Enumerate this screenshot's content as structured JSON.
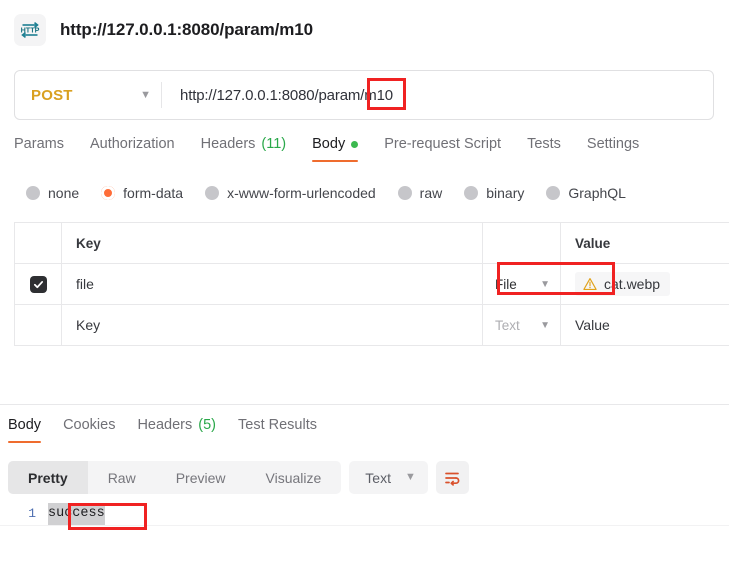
{
  "header": {
    "icon": "http-protocol-icon",
    "title": "http://127.0.0.1:8080/param/m10"
  },
  "url_bar": {
    "method": "POST",
    "method_chevron": "chevron-down-icon",
    "url": "http://127.0.0.1:8080/param/m10"
  },
  "request_tabs": [
    {
      "label": "Params",
      "active": false
    },
    {
      "label": "Authorization",
      "active": false
    },
    {
      "label": "Headers",
      "count": "(11)",
      "active": false
    },
    {
      "label": "Body",
      "active": true,
      "dot": true
    },
    {
      "label": "Pre-request Script",
      "active": false
    },
    {
      "label": "Tests",
      "active": false
    },
    {
      "label": "Settings",
      "active": false
    }
  ],
  "body_types": [
    {
      "label": "none",
      "selected": false
    },
    {
      "label": "form-data",
      "selected": true
    },
    {
      "label": "x-www-form-urlencoded",
      "selected": false
    },
    {
      "label": "raw",
      "selected": false
    },
    {
      "label": "binary",
      "selected": false
    },
    {
      "label": "GraphQL",
      "selected": false
    }
  ],
  "form_data_table": {
    "headers": {
      "key": "Key",
      "value": "Value"
    },
    "rows": [
      {
        "checked": true,
        "key": "file",
        "type": "File",
        "value": "cat.webp",
        "value_has_warning": true
      },
      {
        "checked": false,
        "key_placeholder": "Key",
        "type": "Text",
        "value_placeholder": "Value"
      }
    ]
  },
  "response_tabs": [
    {
      "label": "Body",
      "active": true
    },
    {
      "label": "Cookies",
      "active": false
    },
    {
      "label": "Headers",
      "count": "(5)",
      "active": false
    },
    {
      "label": "Test Results",
      "active": false
    }
  ],
  "response_toolbar": {
    "views": [
      {
        "label": "Pretty",
        "active": true
      },
      {
        "label": "Raw",
        "active": false
      },
      {
        "label": "Preview",
        "active": false
      },
      {
        "label": "Visualize",
        "active": false
      }
    ],
    "format": "Text",
    "format_chevron": "chevron-down-icon",
    "wrap_button": "wrap-text-icon"
  },
  "response_body": {
    "lines": [
      {
        "number": "1",
        "text": "success",
        "selected": true
      }
    ]
  },
  "annotations": {
    "url_param": "m10",
    "file_value": "cat.webp",
    "response_text": "success",
    "color": "#f02222"
  },
  "colors": {
    "accent_orange": "#ff6c37",
    "method_post": "#d9a020",
    "green": "#2aa84a",
    "warning_amber": "#e0a21b"
  }
}
